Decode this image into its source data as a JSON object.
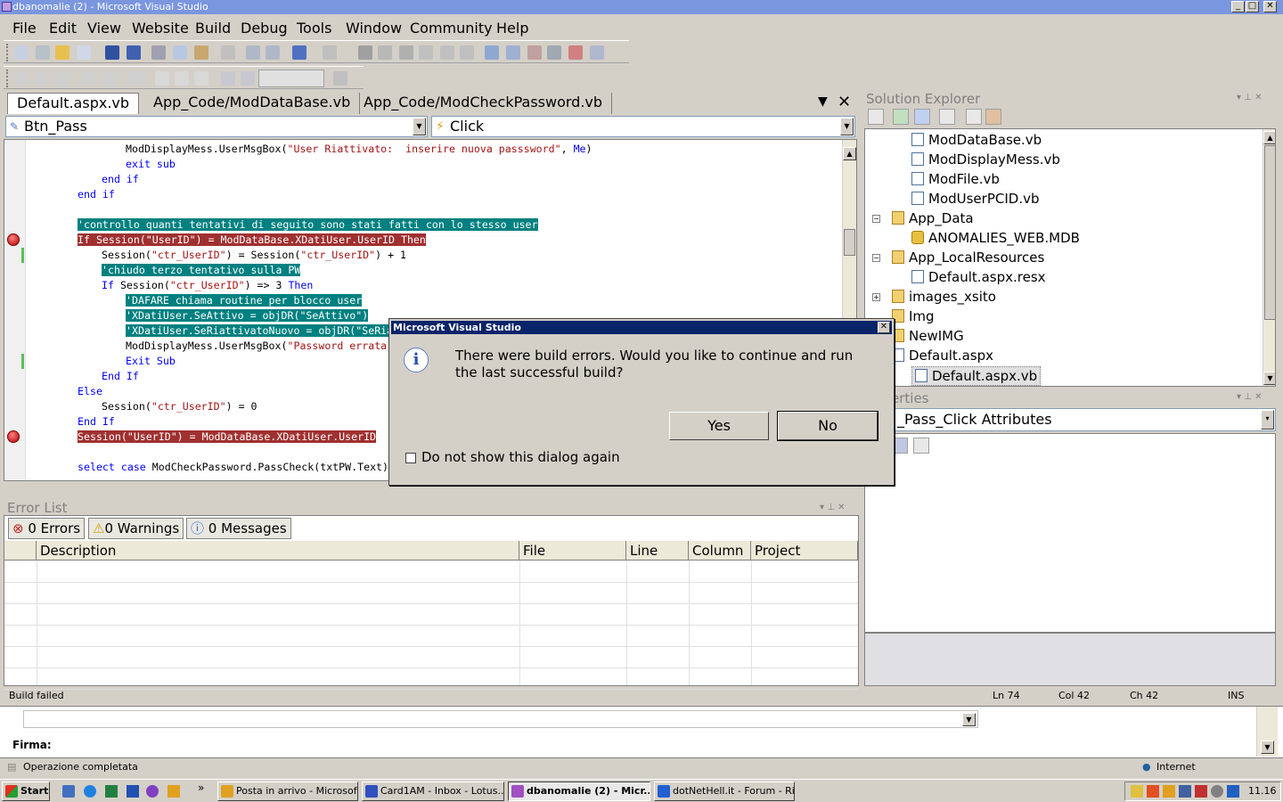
{
  "window": {
    "title": "dbanomalie (2) - Microsoft Visual Studio",
    "min": "_",
    "max": "□",
    "close": "✕"
  },
  "menu": [
    "File",
    "Edit",
    "View",
    "Website",
    "Build",
    "Debug",
    "Tools",
    "Window",
    "Community",
    "Help"
  ],
  "tabs": [
    {
      "label": "Default.aspx.vb"
    },
    {
      "label": "App_Code/ModDataBase.vb"
    },
    {
      "label": "App_Code/ModCheckPassword.vb"
    }
  ],
  "editor": {
    "object_combo": "Btn_Pass",
    "method_combo": "Click",
    "lines": [
      {
        "indent": 8,
        "parts": [
          {
            "t": "ModDisplayMess.UserMsgBox(",
            "c": ""
          },
          {
            "t": "\"User Riattivato:  inserire nuova passsword\"",
            "c": "str"
          },
          {
            "t": ", ",
            "c": ""
          },
          {
            "t": "Me",
            "c": "kw"
          },
          {
            "t": ")",
            "c": ""
          }
        ]
      },
      {
        "indent": 8,
        "parts": [
          {
            "t": "exit sub",
            "c": "kw"
          }
        ]
      },
      {
        "indent": 6,
        "parts": [
          {
            "t": "end if",
            "c": "kw"
          }
        ]
      },
      {
        "indent": 4,
        "parts": [
          {
            "t": "end if",
            "c": "kw"
          }
        ]
      },
      {
        "indent": 0,
        "parts": [
          {
            "t": "",
            "c": ""
          }
        ]
      },
      {
        "indent": 4,
        "hl": "teal",
        "parts": [
          {
            "t": "'controllo quanti tentativi di seguito sono stati fatti con lo stesso user",
            "c": ""
          }
        ]
      },
      {
        "indent": 4,
        "hl": "red",
        "bp": true,
        "parts": [
          {
            "t": "If Session(\"UserID\") = ModDataBase.XDatiUser.UserID Then",
            "c": ""
          }
        ]
      },
      {
        "indent": 6,
        "chg": true,
        "parts": [
          {
            "t": "Session(",
            "c": ""
          },
          {
            "t": "\"ctr_UserID\"",
            "c": "str"
          },
          {
            "t": ") = Session(",
            "c": ""
          },
          {
            "t": "\"ctr_UserID\"",
            "c": "str"
          },
          {
            "t": ") + 1",
            "c": ""
          }
        ]
      },
      {
        "indent": 6,
        "hl": "teal",
        "parts": [
          {
            "t": "'chiudo terzo tentativo sulla PW",
            "c": ""
          }
        ]
      },
      {
        "indent": 6,
        "parts": [
          {
            "t": "If ",
            "c": "kw"
          },
          {
            "t": "Session(",
            "c": ""
          },
          {
            "t": "\"ctr_UserID\"",
            "c": "str"
          },
          {
            "t": ") => 3 ",
            "c": ""
          },
          {
            "t": "Then",
            "c": "kw"
          }
        ]
      },
      {
        "indent": 8,
        "hl": "teal",
        "parts": [
          {
            "t": "'DAFARE chiama routine per blocco user",
            "c": ""
          }
        ]
      },
      {
        "indent": 8,
        "hl": "teal",
        "parts": [
          {
            "t": "'XDatiUser.SeAttivo = objDR(\"SeAttivo\")",
            "c": ""
          }
        ]
      },
      {
        "indent": 8,
        "hl": "teal",
        "parts": [
          {
            "t": "'XDatiUser.SeRiattivatoNuovo = objDR(\"SeRiattivatoNuovo\")",
            "c": ""
          }
        ]
      },
      {
        "indent": 8,
        "parts": [
          {
            "t": "ModDisplayMess.UserMsgBox(",
            "c": ""
          },
          {
            "t": "\"Password errata per 3 volte\"",
            "c": "str"
          },
          {
            "t": ", Me)",
            "c": ""
          }
        ]
      },
      {
        "indent": 8,
        "chg": true,
        "parts": [
          {
            "t": "Exit Sub",
            "c": "kw"
          }
        ]
      },
      {
        "indent": 6,
        "parts": [
          {
            "t": "End If",
            "c": "kw"
          }
        ]
      },
      {
        "indent": 4,
        "parts": [
          {
            "t": "Else",
            "c": "kw"
          }
        ]
      },
      {
        "indent": 6,
        "parts": [
          {
            "t": "Session(",
            "c": ""
          },
          {
            "t": "\"ctr_UserID\"",
            "c": "str"
          },
          {
            "t": ") = 0",
            "c": ""
          }
        ]
      },
      {
        "indent": 4,
        "parts": [
          {
            "t": "End If",
            "c": "kw"
          }
        ]
      },
      {
        "indent": 4,
        "hl": "red",
        "bp": true,
        "parts": [
          {
            "t": "Session(\"UserID\") = ModDataBase.XDatiUser.UserID",
            "c": ""
          }
        ]
      },
      {
        "indent": 0,
        "parts": [
          {
            "t": "",
            "c": ""
          }
        ]
      },
      {
        "indent": 4,
        "parts": [
          {
            "t": "select case ",
            "c": "kw"
          },
          {
            "t": "ModCheckPassword.PassCheck(txtPW.Text)",
            "c": ""
          }
        ]
      }
    ]
  },
  "solution_explorer": {
    "title": "Solution Explorer",
    "items": [
      {
        "label": "ModDataBase.vb",
        "icon": "vb",
        "level": 2
      },
      {
        "label": "ModDisplayMess.vb",
        "icon": "vb",
        "level": 2
      },
      {
        "label": "ModFile.vb",
        "icon": "vb",
        "level": 2
      },
      {
        "label": "ModUserPCID.vb",
        "icon": "vb",
        "level": 2
      },
      {
        "label": "App_Data",
        "icon": "folder-open",
        "level": 1,
        "exp": "-"
      },
      {
        "label": "ANOMALIES_WEB.MDB",
        "icon": "db",
        "level": 2
      },
      {
        "label": "App_LocalResources",
        "icon": "folder-open",
        "level": 1,
        "exp": "-"
      },
      {
        "label": "Default.aspx.resx",
        "icon": "resx",
        "level": 2
      },
      {
        "label": "images_xsito",
        "icon": "folder",
        "level": 1,
        "exp": "+"
      },
      {
        "label": "Img",
        "icon": "folder",
        "level": 1
      },
      {
        "label": "NewIMG",
        "icon": "folder",
        "level": 1
      },
      {
        "label": "Default.aspx",
        "icon": "page",
        "level": 1,
        "exp": "-"
      },
      {
        "label": "Default.aspx.vb",
        "icon": "vb",
        "level": 2,
        "selected": true
      }
    ]
  },
  "properties": {
    "title": "Properties",
    "object": "Btn_Pass_Click Attributes",
    "title_visible": "erties",
    "object_visible": "_Pass_Click Attributes"
  },
  "error_list": {
    "title": "Error List",
    "errors": "0 Errors",
    "warnings": "0 Warnings",
    "messages": "0 Messages",
    "columns": [
      "Description",
      "File",
      "Line",
      "Column",
      "Project"
    ]
  },
  "status": {
    "message": "Build failed",
    "ln": "Ln 74",
    "col": "Col 42",
    "ch": "Ch 42",
    "mode": "INS"
  },
  "browser": {
    "firma_label": "Firma:",
    "status": "Operazione completata",
    "zone": "Internet"
  },
  "dialog": {
    "title": "Microsoft Visual Studio",
    "message": "There were build errors. Would you like to continue and run the last successful build?",
    "yes": "Yes",
    "no": "No",
    "checkbox": "Do not show this dialog again"
  },
  "taskbar": {
    "start": "Start",
    "more": "»",
    "tasks": [
      {
        "label": "Posta in arrivo - Microsof...",
        "color": "#e0a020"
      },
      {
        "label": "Card1AM - Inbox - Lotus...",
        "color": "#3050c0"
      },
      {
        "label": "dbanomalie (2) - Micr...",
        "color": "#a050c0",
        "active": true
      },
      {
        "label": "dotNetHell.it - Forum - Ri...",
        "color": "#2060d0"
      }
    ],
    "clock": "11.16"
  },
  "colors": {
    "titlebar": "#7a96df",
    "dialog_title": "#0a246a",
    "teal_highlight": "#008080",
    "breakpoint_highlight": "#a03030"
  }
}
